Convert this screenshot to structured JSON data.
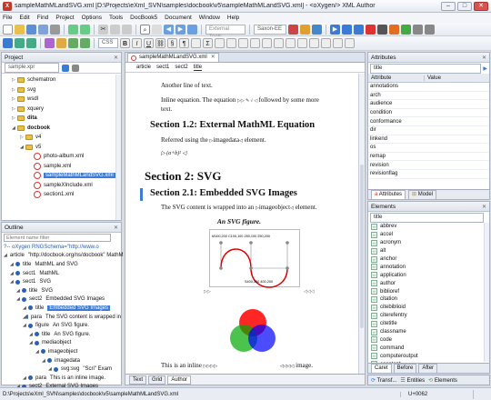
{
  "window": {
    "title": "sampleMathMLandSVG.xml [D:\\Projects\\eXml_SVN\\samples\\docbook\\v5\\sampleMathMLandSVG.xml] - <oXygen/> XML Author",
    "logo": "X"
  },
  "menu": [
    "File",
    "Edit",
    "Find",
    "Project",
    "Options",
    "Tools",
    "DocBook5",
    "Document",
    "Window",
    "Help"
  ],
  "toolbar": {
    "external_tools": "External Tools",
    "saxon": "Saxon-EE",
    "css_combo": "CSS"
  },
  "project": {
    "title": "Project",
    "combo": "sample.xpr",
    "items": [
      {
        "label": "schematron",
        "indent": 1,
        "type": "folder"
      },
      {
        "label": "svg",
        "indent": 1,
        "type": "folder"
      },
      {
        "label": "wsdl",
        "indent": 1,
        "type": "folder"
      },
      {
        "label": "xquery",
        "indent": 1,
        "type": "folder"
      },
      {
        "label": "dita",
        "indent": 1,
        "type": "folder",
        "bold": true
      },
      {
        "label": "docbook",
        "indent": 1,
        "type": "folder",
        "bold": true,
        "open": true
      },
      {
        "label": "v4",
        "indent": 2,
        "type": "folder"
      },
      {
        "label": "v5",
        "indent": 2,
        "type": "folder",
        "open": true
      },
      {
        "label": "photo-album.xml",
        "indent": 3,
        "type": "xml"
      },
      {
        "label": "sample.xml",
        "indent": 3,
        "type": "xml"
      },
      {
        "label": "sampleMathMLandSVG.xml",
        "indent": 3,
        "type": "xml",
        "selected": true
      },
      {
        "label": "sampleXInclude.xml",
        "indent": 3,
        "type": "xml"
      },
      {
        "label": "section1.xml",
        "indent": 3,
        "type": "xml"
      }
    ]
  },
  "outline": {
    "title": "Outline",
    "filter_placeholder": "Element name filter",
    "items": [
      {
        "label": "?-- oXygen RNGSchema=\"http://www.o",
        "indent": 0,
        "pi": true
      },
      {
        "tag": "article",
        "text": "\"http://docbook.org/ns/docbook\" MathM",
        "indent": 0
      },
      {
        "tag": "title",
        "text": "MathML and SVG",
        "indent": 1
      },
      {
        "tag": "sect1",
        "text": "MathML",
        "indent": 1
      },
      {
        "tag": "sect1",
        "text": "SVG",
        "indent": 1
      },
      {
        "tag": "title",
        "text": "SVG",
        "indent": 2
      },
      {
        "tag": "sect2",
        "text": "Embedded SVG Images",
        "indent": 2
      },
      {
        "tag": "title",
        "text": "Embedded SVG Images",
        "indent": 3,
        "selected": true
      },
      {
        "tag": "para",
        "text": "The SVG content is wrapped in",
        "indent": 3
      },
      {
        "tag": "figure",
        "text": "An SVG figure.",
        "indent": 3
      },
      {
        "tag": "title",
        "text": "An SVG figure.",
        "indent": 4
      },
      {
        "tag": "mediaobject",
        "text": "",
        "indent": 4
      },
      {
        "tag": "imageobject",
        "text": "",
        "indent": 5
      },
      {
        "tag": "imagedata",
        "text": "",
        "indent": 6
      },
      {
        "tag": "svg:svg",
        "text": "\"Scri\" Exam",
        "indent": 7
      },
      {
        "tag": "para",
        "text": "This is an inline image.",
        "indent": 3
      },
      {
        "tag": "sect2",
        "text": "External SVG Images",
        "indent": 2
      }
    ]
  },
  "editor": {
    "tab": "sampleMathMLandSVG.xml",
    "breadcrumb": [
      "article",
      "sect1",
      "sect2",
      "title"
    ],
    "para1": "Another line of text.",
    "para2_a": "Inline equation. The equation",
    "para2_b": "followed by some more text.",
    "sec12": "Section 1.2: External MathML Equation",
    "para3": "Referred using the",
    "para3_tag": "imagedata",
    "para3_end": "element.",
    "sec2": "Section 2: SVG",
    "sec21": "Section 2.1: Embedded SVG Images",
    "para4_a": "The SVG content is wrapped into an",
    "para4_tag": "imageobject",
    "para4_b": "element.",
    "figure_title": "An SVG figure.",
    "svg_label1": "M100,200 C100,100 250,100 250,200",
    "svg_label2": "S400,300 400,200",
    "para5": "This is an inline",
    "para5_end": "image.",
    "bottom_tabs": [
      "Text",
      "Grid",
      "Author"
    ],
    "active_bottom_tab": "Author"
  },
  "attributes": {
    "title": "Attributes",
    "combo": "title",
    "col_attr": "Attribute",
    "col_val": "Value",
    "rows": [
      "annotations",
      "arch",
      "audience",
      "condition",
      "conformance",
      "dir",
      "linkend",
      "os",
      "remap",
      "revision",
      "revisionflag"
    ],
    "tabs": [
      "Attributes",
      "Model"
    ]
  },
  "elements": {
    "title": "Elements",
    "combo": "title",
    "items": [
      "abbrev",
      "accel",
      "acronym",
      "alt",
      "anchor",
      "annotation",
      "application",
      "author",
      "biblioref",
      "citation",
      "citebiblioid",
      "citerefentry",
      "citetitle",
      "classname",
      "code",
      "command",
      "computeroutput",
      "constant"
    ],
    "tabs": [
      "Caret",
      "Before",
      "After"
    ]
  },
  "bottom_views": [
    "Transf...",
    "Entities",
    "Elements"
  ],
  "status": {
    "path": "D:\\Projects\\eXml_SVN\\samples\\docbook\\v5\\sampleMathMLandSVG.xml",
    "unicode": "U+0062"
  }
}
